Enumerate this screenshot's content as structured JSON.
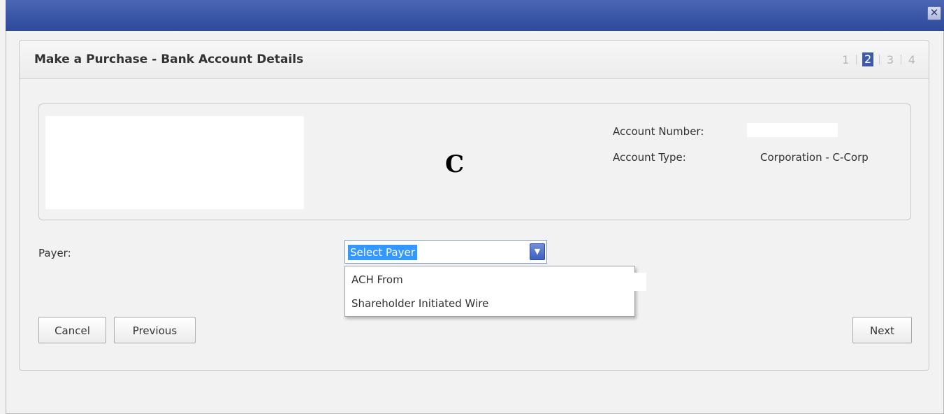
{
  "window": {
    "close_icon": "close-icon",
    "close_glyph": "✕"
  },
  "panel": {
    "title": "Make a Purchase - Bank Account Details",
    "steps": [
      {
        "label": "1",
        "active": false
      },
      {
        "label": "2",
        "active": true
      },
      {
        "label": "3",
        "active": false
      },
      {
        "label": "4",
        "active": false
      }
    ],
    "step_separator": "|"
  },
  "account": {
    "logo_letter": "C",
    "number_label": "Account Number:",
    "number_value": "",
    "type_label": "Account Type:",
    "type_value": "Corporation - C-Corp"
  },
  "payer": {
    "label": "Payer:",
    "selected": "Select Payer",
    "dropdown_icon": "chevron-down-icon",
    "options": [
      {
        "label": "ACH From"
      },
      {
        "label": "Shareholder Initiated Wire"
      }
    ]
  },
  "buttons": {
    "cancel": "Cancel",
    "previous": "Previous",
    "next": "Next"
  },
  "colors": {
    "titlebar": "#3a56a8",
    "active_step": "#3d5aa8",
    "selection_highlight": "#3399ff"
  }
}
